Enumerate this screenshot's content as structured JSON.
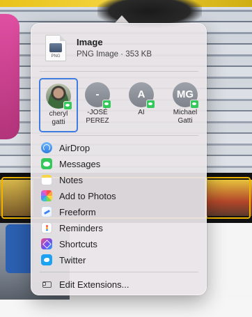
{
  "file": {
    "title": "Image",
    "subtitle": "PNG Image · 353 KB",
    "icon_ext": "PNG",
    "icon": "png-file-icon"
  },
  "contacts": [
    {
      "name_line1": "cheryl",
      "name_line2": "gatti",
      "initials": "",
      "avatar": "photo",
      "selected": true,
      "badge": "messages-badge-icon"
    },
    {
      "name_line1": "-JOSÉ",
      "name_line2": "PEREZ",
      "initials": "-",
      "avatar": "initials",
      "selected": false,
      "badge": "messages-badge-icon"
    },
    {
      "name_line1": "AI",
      "name_line2": "",
      "initials": "A",
      "avatar": "initials",
      "selected": false,
      "badge": "messages-badge-icon"
    },
    {
      "name_line1": "Michael",
      "name_line2": "Gatti",
      "initials": "MG",
      "avatar": "initials",
      "selected": false,
      "badge": "messages-badge-icon"
    }
  ],
  "menu": [
    {
      "label": "AirDrop",
      "icon": "airdrop-icon"
    },
    {
      "label": "Messages",
      "icon": "messages-icon"
    },
    {
      "label": "Notes",
      "icon": "notes-icon"
    },
    {
      "label": "Add to Photos",
      "icon": "photos-icon"
    },
    {
      "label": "Freeform",
      "icon": "freeform-icon"
    },
    {
      "label": "Reminders",
      "icon": "reminders-icon"
    },
    {
      "label": "Shortcuts",
      "icon": "shortcuts-icon"
    },
    {
      "label": "Twitter",
      "icon": "twitter-icon"
    }
  ],
  "footer": {
    "label": "Edit Extensions...",
    "icon": "extensions-icon"
  },
  "colors": {
    "selection_border": "#3f7ce0",
    "messages_green": "#34c759",
    "popover_bg": "#e8e4e7"
  }
}
